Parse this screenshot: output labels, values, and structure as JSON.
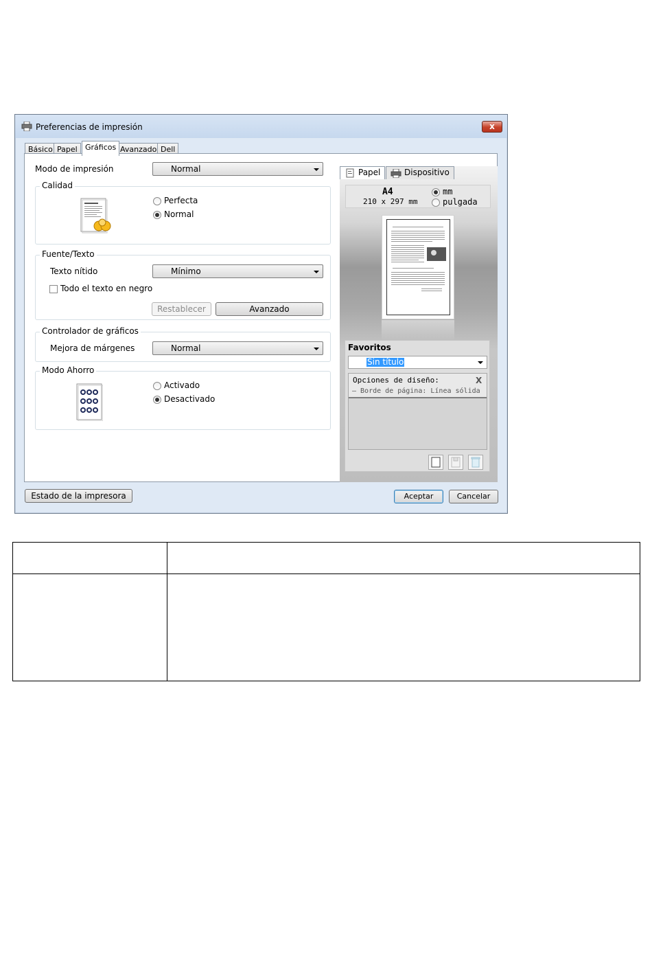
{
  "window": {
    "title": "Preferencias de impresión",
    "close_glyph": "x",
    "tabs": [
      "Básico",
      "Papel",
      "Gráficos",
      "Avanzado",
      "Dell"
    ],
    "active_tab": "Gráficos"
  },
  "left": {
    "print_mode": {
      "label": "Modo de impresión",
      "value": "Normal"
    },
    "quality": {
      "title": "Calidad",
      "options": [
        {
          "label": "Perfecta",
          "selected": false
        },
        {
          "label": "Normal",
          "selected": true
        }
      ]
    },
    "font_text": {
      "title": "Fuente/Texto",
      "sharp_text_label": "Texto nítido",
      "sharp_text_value": "Mínimo",
      "all_black_label": "Todo el texto en negro",
      "all_black_checked": false,
      "reset_label": "Restablecer",
      "advanced_label": "Avanzado"
    },
    "graphics_controller": {
      "title": "Controlador de gráficos",
      "edge_label": "Mejora de márgenes",
      "edge_value": "Normal"
    },
    "eco_mode": {
      "title": "Modo Ahorro",
      "options": [
        {
          "label": "Activado",
          "selected": false
        },
        {
          "label": "Desactivado",
          "selected": true
        }
      ]
    }
  },
  "right": {
    "tabs": [
      "Papel",
      "Dispositivo"
    ],
    "paper_name": "A4",
    "paper_dims": "210 x 297 mm",
    "units": [
      {
        "label": "mm",
        "selected": true
      },
      {
        "label": "pulgada",
        "selected": false
      }
    ],
    "favorites": {
      "title": "Favoritos",
      "selected": "Sin título",
      "options_title": "Opciones de diseño:",
      "options_item": "– Borde de página: Línea sólida",
      "close_glyph": "X"
    }
  },
  "footer": {
    "printer_status_label": "Estado de la impresora",
    "ok_label": "Aceptar",
    "cancel_label": "Cancelar"
  },
  "colors": {
    "accent": "#3399ff",
    "window_frame": "#dfe9f5",
    "close_red": "#c7432a"
  },
  "icons": {
    "title": "printer-icon",
    "quality": "document-quality-icon",
    "eco": "eco-dots-icon",
    "paper_tab": "paper-icon",
    "device_tab": "printer-icon",
    "fav_new": "new-icon",
    "fav_save": "save-icon",
    "fav_delete": "trash-icon"
  }
}
